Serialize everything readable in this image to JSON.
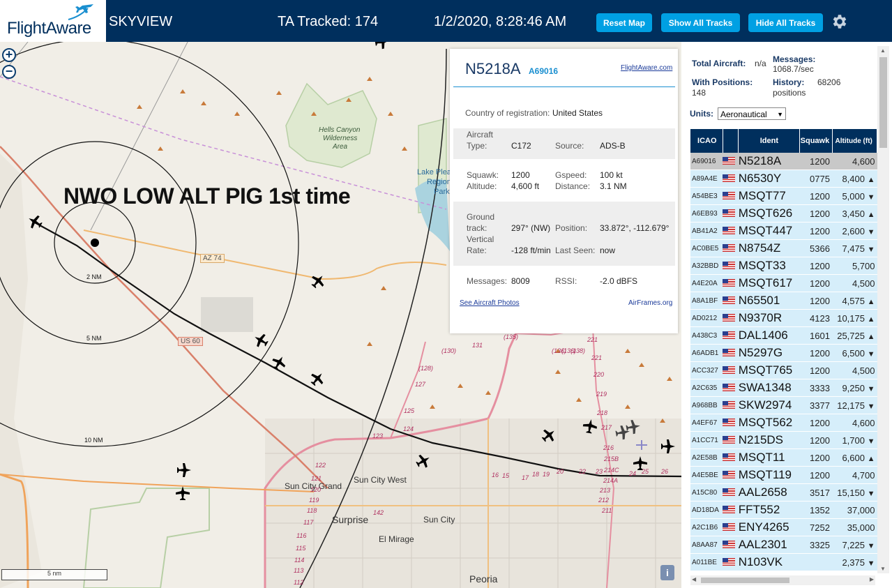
{
  "header": {
    "logo": "FlightAware",
    "app_name": "SKYVIEW",
    "tracked": "TA Tracked: 174",
    "datetime": "1/2/2020, 8:28:46 AM",
    "reset_map": "Reset Map",
    "show_all": "Show All Tracks",
    "hide_all": "Hide All Tracks",
    "settings_icon": "gear-icon"
  },
  "map": {
    "zoom_in": "+",
    "zoom_out": "−",
    "annotation": "NWO LOW ALT PIG 1st time",
    "scale": "5 nm",
    "info": "i",
    "ring_labels": [
      "2 NM",
      "5 NM",
      "10 NM"
    ],
    "labels": {
      "hells_canyon": "Hells Canyon",
      "wilderness": "Wilderness",
      "area": "Area",
      "lake_pleasant": "Lake Plea",
      "regional": "Regiona",
      "park": "Park",
      "az74": "AZ 74",
      "us60": "US 60",
      "sun_city_grand": "Sun City Grand",
      "sun_city_west": "Sun City West",
      "surprise": "Surprise",
      "sun_city": "Sun City",
      "el_mirage": "El Mirage",
      "peoria": "Peoria"
    },
    "road_numbers": [
      "(130)",
      "131",
      "(135)",
      "(136)",
      "(138)",
      "(128)",
      "127",
      "125",
      "124",
      "123",
      "(136)",
      "221",
      "221",
      "220",
      "219",
      "218",
      "217",
      "216",
      "215B",
      "214C",
      "214A",
      "213",
      "212",
      "211",
      "24",
      "25",
      "26",
      "20",
      "22",
      "23",
      "18",
      "19",
      "17",
      "16",
      "15",
      "122",
      "121",
      "120",
      "119",
      "118",
      "117",
      "116",
      "115",
      "114",
      "113",
      "112",
      "142"
    ]
  },
  "popup": {
    "ident": "N5218A",
    "hex": "A69016",
    "link": "FlightAware.com",
    "country_label": "Country of registration:",
    "country": "United States",
    "type_label_1": "Aircraft",
    "type_label_2": "Type:",
    "type": "C172",
    "source_label": "Source:",
    "source": "ADS-B",
    "squawk_label": "Squawk:",
    "squawk": "1200",
    "gspeed_label": "Gspeed:",
    "gspeed": "100 kt",
    "altitude_label": "Altitude:",
    "altitude": "4,600 ft",
    "distance_label": "Distance:",
    "distance": "3.1 NM",
    "track_label_1": "Ground",
    "track_label_2": "track:",
    "track": "297° (NW)",
    "position_label": "Position:",
    "position": "33.872°, -112.679°",
    "vrate_label_1": "Vertical",
    "vrate_label_2": "Rate:",
    "vrate": "-128 ft/min",
    "lastseen_label": "Last Seen:",
    "lastseen": "now",
    "messages_label": "Messages:",
    "messages": "8009",
    "rssi_label": "RSSI:",
    "rssi": "-2.0 dBFS",
    "photos_link": "See Aircraft Photos",
    "airframes_link": "AirFrames.org"
  },
  "sidebar": {
    "total_label": "Total Aircraft:",
    "total": "n/a",
    "messages_label": "Messages:",
    "messages": "1068.7/sec",
    "positions_label": "With Positions:",
    "positions": "148",
    "history_label": "History:",
    "history": "68206",
    "history_unit": "positions",
    "units_label": "Units:",
    "units_value": "Aeronautical",
    "columns": [
      "ICAO",
      "",
      "Ident",
      "Squawk",
      "Altitude (ft)"
    ],
    "rows": [
      {
        "icao": "A69016",
        "ident": "N5218A",
        "squawk": "1200",
        "alt": "4,600",
        "trend": "",
        "selected": true
      },
      {
        "icao": "A89A4E",
        "ident": "N6530Y",
        "squawk": "0775",
        "alt": "8,400",
        "trend": "▲"
      },
      {
        "icao": "A54BE3",
        "ident": "MSQT77",
        "squawk": "1200",
        "alt": "5,000",
        "trend": "▼"
      },
      {
        "icao": "A6EB93",
        "ident": "MSQT626",
        "squawk": "1200",
        "alt": "3,450",
        "trend": "▲"
      },
      {
        "icao": "AB41A2",
        "ident": "MSQT447",
        "squawk": "1200",
        "alt": "2,600",
        "trend": "▼"
      },
      {
        "icao": "AC0BE5",
        "ident": "N8754Z",
        "squawk": "5366",
        "alt": "7,475",
        "trend": "▼"
      },
      {
        "icao": "A32BBD",
        "ident": "MSQT33",
        "squawk": "1200",
        "alt": "5,700",
        "trend": ""
      },
      {
        "icao": "A4E20A",
        "ident": "MSQT617",
        "squawk": "1200",
        "alt": "4,500",
        "trend": ""
      },
      {
        "icao": "A8A1BF",
        "ident": "N65501",
        "squawk": "1200",
        "alt": "4,575",
        "trend": "▲"
      },
      {
        "icao": "AD0212",
        "ident": "N9370R",
        "squawk": "4123",
        "alt": "10,175",
        "trend": "▲"
      },
      {
        "icao": "A438C3",
        "ident": "DAL1406",
        "squawk": "1601",
        "alt": "25,725",
        "trend": "▲"
      },
      {
        "icao": "A6ADB1",
        "ident": "N5297G",
        "squawk": "1200",
        "alt": "6,500",
        "trend": "▼"
      },
      {
        "icao": "ACC327",
        "ident": "MSQT765",
        "squawk": "1200",
        "alt": "4,500",
        "trend": ""
      },
      {
        "icao": "A2C635",
        "ident": "SWA1348",
        "squawk": "3333",
        "alt": "9,250",
        "trend": "▼"
      },
      {
        "icao": "A968BB",
        "ident": "SKW2974",
        "squawk": "3377",
        "alt": "12,175",
        "trend": "▼"
      },
      {
        "icao": "A4EF67",
        "ident": "MSQT562",
        "squawk": "1200",
        "alt": "4,600",
        "trend": ""
      },
      {
        "icao": "A1CC71",
        "ident": "N215DS",
        "squawk": "1200",
        "alt": "1,700",
        "trend": "▼"
      },
      {
        "icao": "A2E58B",
        "ident": "MSQT11",
        "squawk": "1200",
        "alt": "6,600",
        "trend": "▲"
      },
      {
        "icao": "A4E5BE",
        "ident": "MSQT119",
        "squawk": "1200",
        "alt": "4,700",
        "trend": ""
      },
      {
        "icao": "A15C80",
        "ident": "AAL2658",
        "squawk": "3517",
        "alt": "15,150",
        "trend": "▼"
      },
      {
        "icao": "AD18DA",
        "ident": "FFT552",
        "squawk": "1352",
        "alt": "37,000",
        "trend": ""
      },
      {
        "icao": "A2C1B6",
        "ident": "ENY4265",
        "squawk": "7252",
        "alt": "35,000",
        "trend": ""
      },
      {
        "icao": "A8AA87",
        "ident": "AAL2301",
        "squawk": "3325",
        "alt": "7,225",
        "trend": "▼"
      },
      {
        "icao": "A011BE",
        "ident": "N103VK",
        "squawk": "",
        "alt": "2,375",
        "trend": "▼"
      }
    ]
  }
}
